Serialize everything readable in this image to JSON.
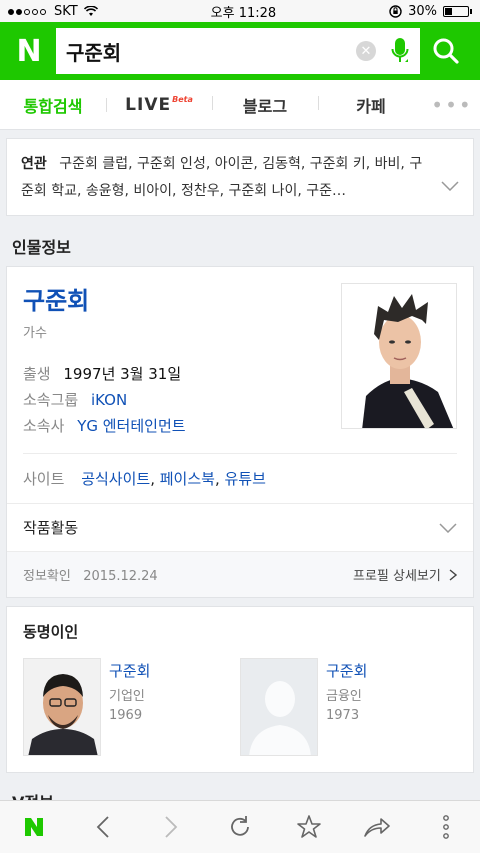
{
  "status": {
    "carrier": "SKT",
    "time": "오후 11:28",
    "battery": "30%",
    "battery_level": 0.3
  },
  "search": {
    "logo": "N",
    "query": "구준회"
  },
  "tabs": [
    {
      "label": "통합검색"
    },
    {
      "label": "LIVE",
      "badge": "Beta"
    },
    {
      "label": "블로그"
    },
    {
      "label": "카페"
    }
  ],
  "related": {
    "label": "연관",
    "text": "구준회 클럽, 구준회 인성, 아이콘, 김동혁, 구준회 키, 바비, 구준회 학교, 송윤형, 비아이, 정찬우, 구준회 나이, 구준…"
  },
  "person_info": {
    "section_title": "인물정보",
    "name": "구준회",
    "job": "가수",
    "birth_label": "출생",
    "birth_value": "1997년 3월 31일",
    "group_label": "소속그룹",
    "group_value": "iKON",
    "agency_label": "소속사",
    "agency_value": "YG 엔터테인먼트",
    "site_label": "사이트",
    "site_links": [
      "공식사이트",
      "페이스북",
      "유튜브"
    ],
    "works_label": "작품활동",
    "confirm_label": "정보확인",
    "confirm_date": "2015.12.24",
    "profile_more": "프로필 상세보기"
  },
  "same_name": {
    "title": "동명이인",
    "people": [
      {
        "name": "구준회",
        "job": "기업인",
        "year": "1969"
      },
      {
        "name": "구준회",
        "job": "금융인",
        "year": "1973"
      }
    ]
  },
  "vinfo": {
    "title": "V정보"
  },
  "colors": {
    "brand": "#1ec800",
    "link": "#1051b6"
  }
}
